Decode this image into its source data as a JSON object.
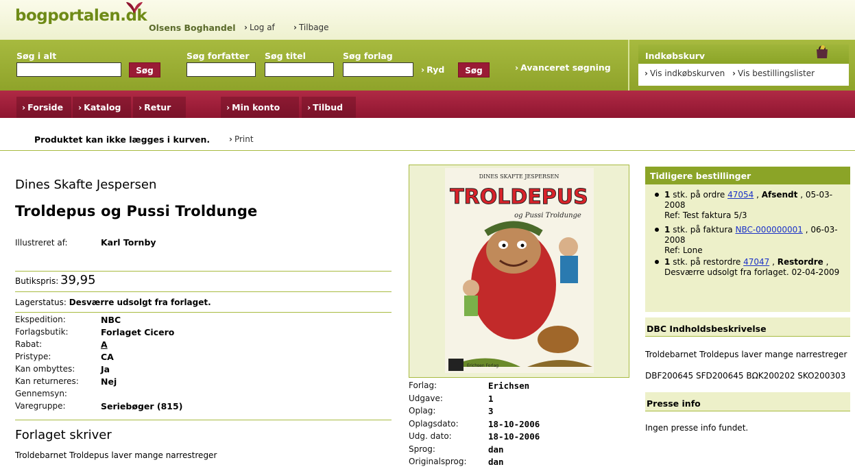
{
  "header": {
    "logo": "bogportalen.dk",
    "shop_name": "Olsens Boghandel",
    "logout": "Log af",
    "back": "Tilbage"
  },
  "search": {
    "all_label": "Søg i alt",
    "all_button": "Søg",
    "author_label": "Søg forfatter",
    "title_label": "Søg titel",
    "publisher_label": "Søg forlag",
    "clear": "Ryd",
    "button": "Søg",
    "advanced": "Avanceret søgning"
  },
  "cart": {
    "title": "Indkøbskurv",
    "view_cart": "Vis indkøbskurven",
    "view_orders": "Vis bestillingslister"
  },
  "nav": {
    "tabs": [
      "Forside",
      "Katalog",
      "Retur",
      "Min konto",
      "Tilbud"
    ]
  },
  "status": {
    "message": "Produktet kan ikke lægges i kurven.",
    "print": "Print"
  },
  "product": {
    "author": "Dines Skafte Jespersen",
    "title": "Troldepus og Pussi Troldunge",
    "illustrated_label": "Illustreret af:",
    "illustrator": "Karl Tornby",
    "price_label": "Butikspris:",
    "price": "39,95",
    "stock_label": "Lagerstatus:",
    "stock_value": "Desværre udsolgt fra forlaget.",
    "details": [
      {
        "label": "Ekspedition:",
        "value": "NBC"
      },
      {
        "label": "Forlagsbutik:",
        "value": "Forlaget Cicero"
      },
      {
        "label": "Rabat:",
        "value": "A"
      },
      {
        "label": "Pristype:",
        "value": "CA"
      },
      {
        "label": "Kan ombyttes:",
        "value": "Ja"
      },
      {
        "label": "Kan returneres:",
        "value": "Nej"
      },
      {
        "label": "Gennemsyn:",
        "value": ""
      },
      {
        "label": "Varegruppe:",
        "value": "Seriebøger (815)"
      }
    ],
    "publisher_says_heading": "Forlaget skriver",
    "publisher_says_text": "Troldebarnet Troldepus laver mange narrestreger",
    "cover": {
      "author_line": "DINES SKAFTE JESPERSEN",
      "title_line1": "TROLDEPUS",
      "title_line2": "og Pussi Troldunge",
      "logo_text": "Erichsen Forlag"
    },
    "pub_details": [
      {
        "label": "Forlag:",
        "value": "Erichsen"
      },
      {
        "label": "Udgave:",
        "value": "1"
      },
      {
        "label": "Oplag:",
        "value": "3"
      },
      {
        "label": "Oplagsdato:",
        "value": "18-10-2006"
      },
      {
        "label": "Udg. dato:",
        "value": "18-10-2006"
      },
      {
        "label": "Sprog:",
        "value": "dan"
      },
      {
        "label": "Originalsprog:",
        "value": "dan"
      }
    ]
  },
  "previous_orders": {
    "title": "Tidligere bestillinger",
    "items": [
      {
        "qty": "1",
        "pre": "stk. på ordre",
        "link": "47054",
        "status": "Afsendt",
        "date": ", 05-03-2008",
        "ref": "Ref: Test faktura 5/3"
      },
      {
        "qty": "1",
        "pre": "stk. på faktura",
        "link": "NBC-000000001",
        "status": "",
        "date": ", 06-03-2008",
        "ref": "Ref: Lone"
      },
      {
        "qty": "1",
        "pre": "stk. på restordre",
        "link": "47047",
        "status": "Restordre",
        "date": ", Desværre udsolgt fra forlaget. 02-04-2009",
        "ref": ""
      }
    ]
  },
  "dbc": {
    "title": "DBC Indholdsbeskrivelse",
    "text": "Troldebarnet Troldepus laver mange narrestreger",
    "codes": "DBF200645 SFD200645 BΩK200202 SKO200303"
  },
  "press": {
    "title": "Presse info",
    "text": "Ingen presse info fundet."
  },
  "colors": {
    "green": "#8ba427",
    "maroon": "#8f1530",
    "link": "#1a31c8"
  }
}
